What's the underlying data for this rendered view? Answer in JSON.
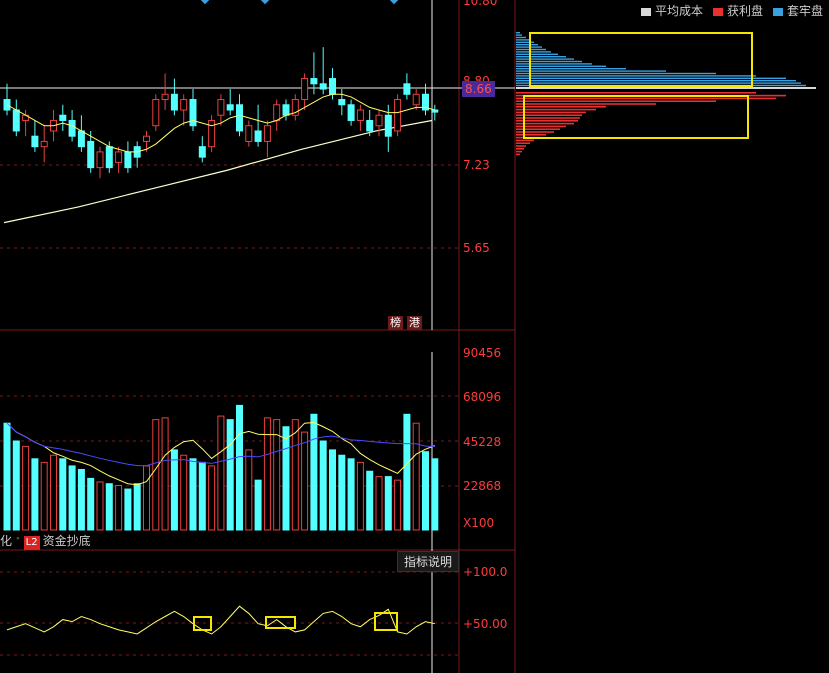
{
  "legend": [
    {
      "label": "平均成本",
      "color": "#d8d8d8"
    },
    {
      "label": "获利盘",
      "color": "#e83030"
    },
    {
      "label": "套牢盘",
      "color": "#3aa0e0"
    }
  ],
  "price_axis": {
    "top_label": "10.80",
    "labels": [
      "8.80",
      "7.23",
      "5.65"
    ],
    "current": "8.66"
  },
  "volume_axis": {
    "labels": [
      "90456",
      "68096",
      "45228",
      "22868"
    ],
    "unit": "X100"
  },
  "indicator_axis": {
    "labels": [
      "+100.0",
      "+50.00"
    ]
  },
  "tags": {
    "bang": "榜",
    "gang": "港"
  },
  "indicator_bar": {
    "left_text": "化",
    "l2": "L2",
    "name": "资金抄底",
    "help_button": "指标说明"
  },
  "colors": {
    "up": "#e84040",
    "down": "#54ffff",
    "ma_short": "#ffff66",
    "ma_long": "#ffffcc",
    "vol_ma": "#4a4aff",
    "highlight": "#f5e600"
  },
  "chart_data": {
    "type": "candlestick",
    "price_ylim": [
      4.5,
      10.8
    ],
    "candles": [
      {
        "o": 8.9,
        "h": 9.2,
        "l": 8.6,
        "c": 8.7
      },
      {
        "o": 8.7,
        "h": 8.9,
        "l": 8.2,
        "c": 8.3
      },
      {
        "o": 8.5,
        "h": 8.7,
        "l": 8.2,
        "c": 8.6
      },
      {
        "o": 8.2,
        "h": 8.5,
        "l": 7.9,
        "c": 8.0
      },
      {
        "o": 8.0,
        "h": 8.4,
        "l": 7.7,
        "c": 8.1
      },
      {
        "o": 8.3,
        "h": 8.7,
        "l": 8.1,
        "c": 8.5
      },
      {
        "o": 8.6,
        "h": 8.8,
        "l": 8.3,
        "c": 8.5
      },
      {
        "o": 8.5,
        "h": 8.7,
        "l": 8.1,
        "c": 8.2
      },
      {
        "o": 8.3,
        "h": 8.6,
        "l": 7.9,
        "c": 8.0
      },
      {
        "o": 8.1,
        "h": 8.3,
        "l": 7.5,
        "c": 7.6
      },
      {
        "o": 7.6,
        "h": 8.0,
        "l": 7.4,
        "c": 7.9
      },
      {
        "o": 8.0,
        "h": 8.1,
        "l": 7.5,
        "c": 7.6
      },
      {
        "o": 7.7,
        "h": 8.0,
        "l": 7.5,
        "c": 7.9
      },
      {
        "o": 7.9,
        "h": 8.1,
        "l": 7.5,
        "c": 7.6
      },
      {
        "o": 8.0,
        "h": 8.1,
        "l": 7.6,
        "c": 7.8
      },
      {
        "o": 8.1,
        "h": 8.3,
        "l": 7.9,
        "c": 8.2
      },
      {
        "o": 8.4,
        "h": 9.0,
        "l": 8.3,
        "c": 8.9
      },
      {
        "o": 8.9,
        "h": 9.4,
        "l": 8.7,
        "c": 9.0
      },
      {
        "o": 9.0,
        "h": 9.3,
        "l": 8.6,
        "c": 8.7
      },
      {
        "o": 8.7,
        "h": 9.0,
        "l": 8.4,
        "c": 8.9
      },
      {
        "o": 8.9,
        "h": 9.1,
        "l": 8.3,
        "c": 8.4
      },
      {
        "o": 8.0,
        "h": 8.2,
        "l": 7.7,
        "c": 7.8
      },
      {
        "o": 8.0,
        "h": 8.6,
        "l": 7.9,
        "c": 8.5
      },
      {
        "o": 8.6,
        "h": 9.0,
        "l": 8.4,
        "c": 8.9
      },
      {
        "o": 8.8,
        "h": 9.1,
        "l": 8.6,
        "c": 8.7
      },
      {
        "o": 8.8,
        "h": 9.0,
        "l": 8.2,
        "c": 8.3
      },
      {
        "o": 8.1,
        "h": 8.5,
        "l": 8.0,
        "c": 8.4
      },
      {
        "o": 8.3,
        "h": 8.8,
        "l": 8.0,
        "c": 8.1
      },
      {
        "o": 8.1,
        "h": 8.5,
        "l": 7.8,
        "c": 8.4
      },
      {
        "o": 8.5,
        "h": 8.9,
        "l": 8.3,
        "c": 8.8
      },
      {
        "o": 8.8,
        "h": 8.9,
        "l": 8.5,
        "c": 8.6
      },
      {
        "o": 8.6,
        "h": 9.0,
        "l": 8.5,
        "c": 8.9
      },
      {
        "o": 8.9,
        "h": 9.4,
        "l": 8.7,
        "c": 9.3
      },
      {
        "o": 9.3,
        "h": 9.8,
        "l": 9.0,
        "c": 9.2
      },
      {
        "o": 9.2,
        "h": 9.9,
        "l": 9.0,
        "c": 9.1
      },
      {
        "o": 9.3,
        "h": 9.5,
        "l": 8.9,
        "c": 9.0
      },
      {
        "o": 8.9,
        "h": 9.1,
        "l": 8.6,
        "c": 8.8
      },
      {
        "o": 8.8,
        "h": 8.9,
        "l": 8.4,
        "c": 8.5
      },
      {
        "o": 8.5,
        "h": 8.8,
        "l": 8.3,
        "c": 8.7
      },
      {
        "o": 8.5,
        "h": 8.7,
        "l": 8.2,
        "c": 8.3
      },
      {
        "o": 8.4,
        "h": 8.7,
        "l": 8.2,
        "c": 8.6
      },
      {
        "o": 8.6,
        "h": 8.8,
        "l": 7.9,
        "c": 8.2
      },
      {
        "o": 8.3,
        "h": 9.0,
        "l": 8.2,
        "c": 8.9
      },
      {
        "o": 9.2,
        "h": 9.4,
        "l": 8.9,
        "c": 9.0
      },
      {
        "o": 8.8,
        "h": 9.1,
        "l": 8.7,
        "c": 9.0
      },
      {
        "o": 9.0,
        "h": 9.2,
        "l": 8.6,
        "c": 8.7
      },
      {
        "o": 8.7,
        "h": 8.8,
        "l": 8.5,
        "c": 8.66
      }
    ],
    "ma_short": [
      8.8,
      8.7,
      8.6,
      8.5,
      8.4,
      8.4,
      8.45,
      8.4,
      8.3,
      8.2,
      8.1,
      8.0,
      7.95,
      7.9,
      7.9,
      7.95,
      8.05,
      8.2,
      8.35,
      8.45,
      8.5,
      8.45,
      8.4,
      8.45,
      8.55,
      8.6,
      8.55,
      8.5,
      8.45,
      8.5,
      8.6,
      8.65,
      8.75,
      8.85,
      8.95,
      9.0,
      9.0,
      8.95,
      8.85,
      8.75,
      8.7,
      8.65,
      8.65,
      8.7,
      8.75,
      8.75,
      8.7
    ],
    "ma_long_line": [
      {
        "x": 0,
        "y": 6.55
      },
      {
        "x": 8,
        "y": 6.85
      },
      {
        "x": 16,
        "y": 7.2
      },
      {
        "x": 24,
        "y": 7.55
      },
      {
        "x": 32,
        "y": 7.95
      },
      {
        "x": 40,
        "y": 8.3
      },
      {
        "x": 46,
        "y": 8.5
      }
    ],
    "volume": [
      60000,
      50000,
      47000,
      40000,
      38000,
      42000,
      40000,
      36000,
      34000,
      29000,
      27000,
      26000,
      25000,
      23000,
      26000,
      36000,
      62000,
      63000,
      45000,
      42000,
      40000,
      38000,
      36000,
      64000,
      62000,
      70000,
      45000,
      28000,
      63000,
      62000,
      58000,
      62000,
      55000,
      65000,
      50000,
      45000,
      42000,
      40000,
      38000,
      33000,
      30000,
      30000,
      28000,
      65000,
      60000,
      44000,
      40000
    ],
    "volume_ylim": [
      0,
      100000
    ],
    "indicator": [
      42,
      45,
      48,
      44,
      40,
      45,
      52,
      50,
      55,
      52,
      48,
      45,
      42,
      40,
      38,
      44,
      50,
      55,
      60,
      55,
      48,
      42,
      38,
      45,
      55,
      65,
      58,
      48,
      46,
      52,
      45,
      40,
      42,
      50,
      58,
      60,
      55,
      48,
      45,
      52,
      56,
      62,
      40,
      38,
      45,
      50,
      48
    ],
    "indicator_ylim": [
      0,
      110
    ],
    "volume_profile_upper": [
      4,
      6,
      10,
      14,
      18,
      22,
      26,
      30,
      35,
      42,
      50,
      58,
      66,
      76,
      90,
      110,
      150,
      200,
      240,
      270,
      280,
      285,
      290
    ],
    "volume_profile_lower": [
      240,
      270,
      260,
      200,
      140,
      90,
      80,
      70,
      66,
      64,
      62,
      58,
      50,
      44,
      38,
      30,
      24,
      18,
      14,
      10,
      8,
      6,
      4
    ]
  }
}
